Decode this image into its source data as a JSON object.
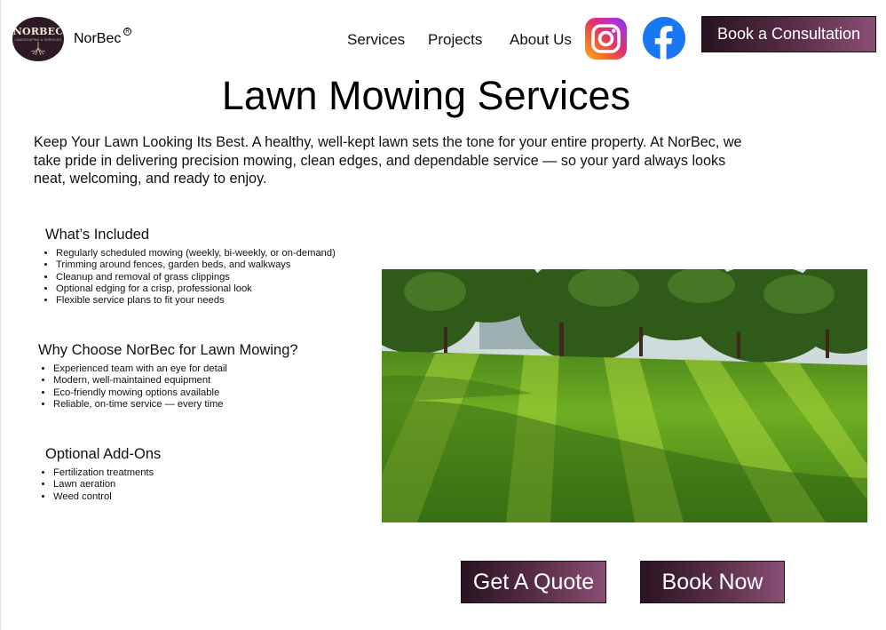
{
  "brand": {
    "logo_text": "NORBEC",
    "logo_subtext": "LANDSCAPING & SERVICES",
    "name": "NorBec",
    "reg_mark": "R"
  },
  "nav": {
    "services": "Services",
    "projects": "Projects",
    "about": "About Us"
  },
  "social": {
    "instagram": "instagram-icon",
    "facebook": "facebook-icon"
  },
  "header_button": "Book a Consultation",
  "page": {
    "title": "Lawn Mowing Services",
    "intro": "Keep Your Lawn Looking Its Best. A healthy, well-kept lawn sets the tone for your entire property. At NorBec, we take pride in delivering precision mowing, clean edges, and dependable service — so your yard always looks neat, welcoming, and ready to enjoy."
  },
  "sections": [
    {
      "heading": "What’s Included",
      "items": [
        "Regularly scheduled mowing (weekly, bi-weekly, or on-demand)",
        "Trimming around fences, garden beds, and walkways",
        "Cleanup and removal of grass clippings",
        "Optional edging for a crisp, professional look",
        "Flexible service plans to fit your needs"
      ]
    },
    {
      "heading": "Why Choose NorBec for Lawn Mowing?",
      "items": [
        "Experienced team with an eye for detail",
        "Modern, well-maintained equipment",
        "Eco-friendly mowing options available",
        "Reliable, on-time service — every time"
      ]
    },
    {
      "heading": "Optional Add-Ons",
      "items": [
        "Fertilization treatments",
        "Lawn aeration",
        "Weed control"
      ]
    }
  ],
  "cta": {
    "quote": "Get A Quote",
    "book": "Book Now"
  },
  "colors": {
    "button_dark": "#271320",
    "button_light": "#8a4e75",
    "facebook_blue": "#1877f2"
  }
}
